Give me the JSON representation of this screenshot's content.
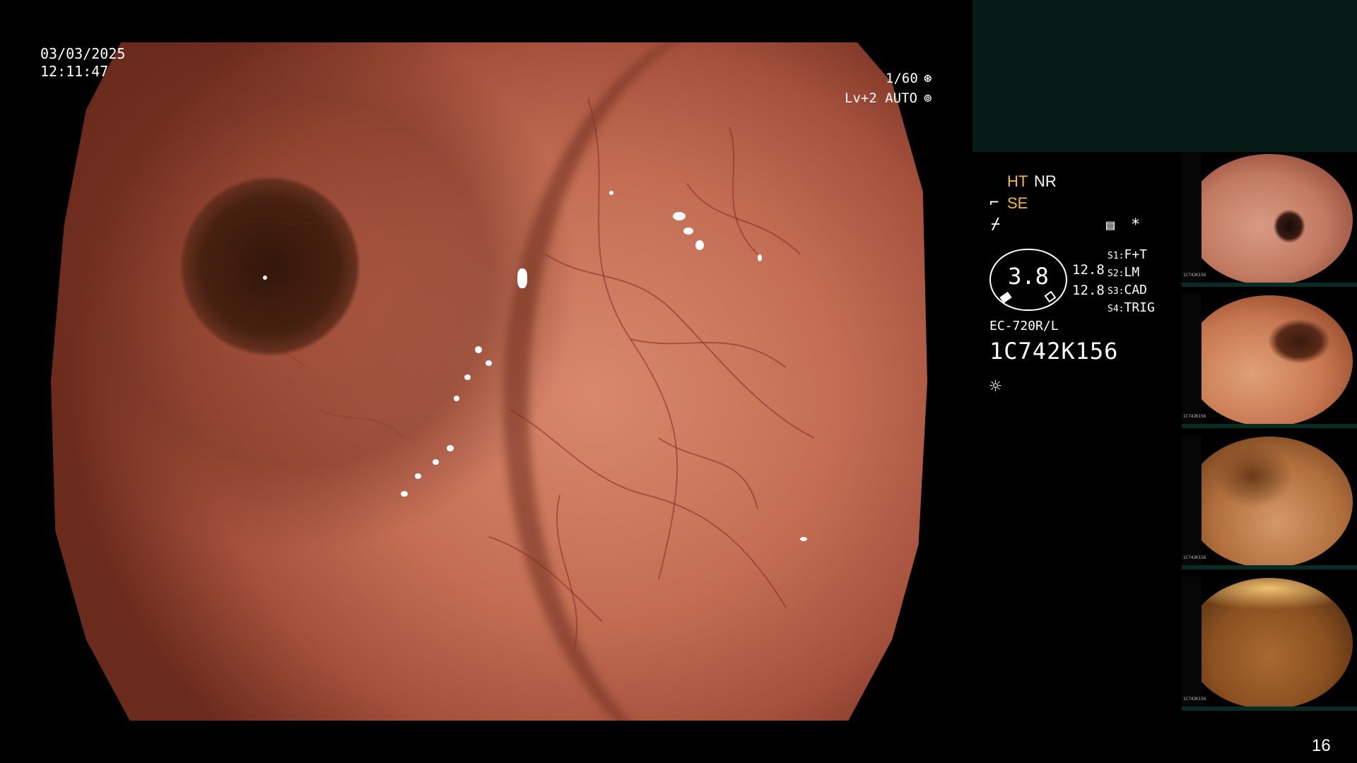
{
  "overlay": {
    "date": "03/03/2025",
    "time": "12:11:47",
    "shutter": "1/60",
    "shutter_icon": "⊛",
    "level": "Lv+2 AUTO",
    "level_icon": "⊚"
  },
  "panel": {
    "ht": "HT",
    "nr": "NR",
    "se_icon": "⌐",
    "se": "SE",
    "zap_icon": "⌿",
    "monitor_icon": "▤",
    "asterisk": "*",
    "gauge_value": "3.8",
    "value_1": "12.8",
    "value_2": "12.8",
    "s_items": [
      {
        "key": "S1:",
        "value": "F+T"
      },
      {
        "key": "S2:",
        "value": "LM"
      },
      {
        "key": "S3:",
        "value": "CAD"
      },
      {
        "key": "S4:",
        "value": "TRIG"
      }
    ],
    "model": "EC-720R/L",
    "serial": "1C742K156",
    "sun_icon": "☼"
  },
  "thumbnails": [
    {
      "strip_serial": "1C742K156"
    },
    {
      "strip_serial": "1C742K156"
    },
    {
      "strip_serial": "1C742K156"
    },
    {
      "strip_serial": "1C742K156"
    }
  ],
  "page_number": "16",
  "colors": {
    "accent_yellow": "#f3b93a",
    "panel_box": "#061a16"
  }
}
